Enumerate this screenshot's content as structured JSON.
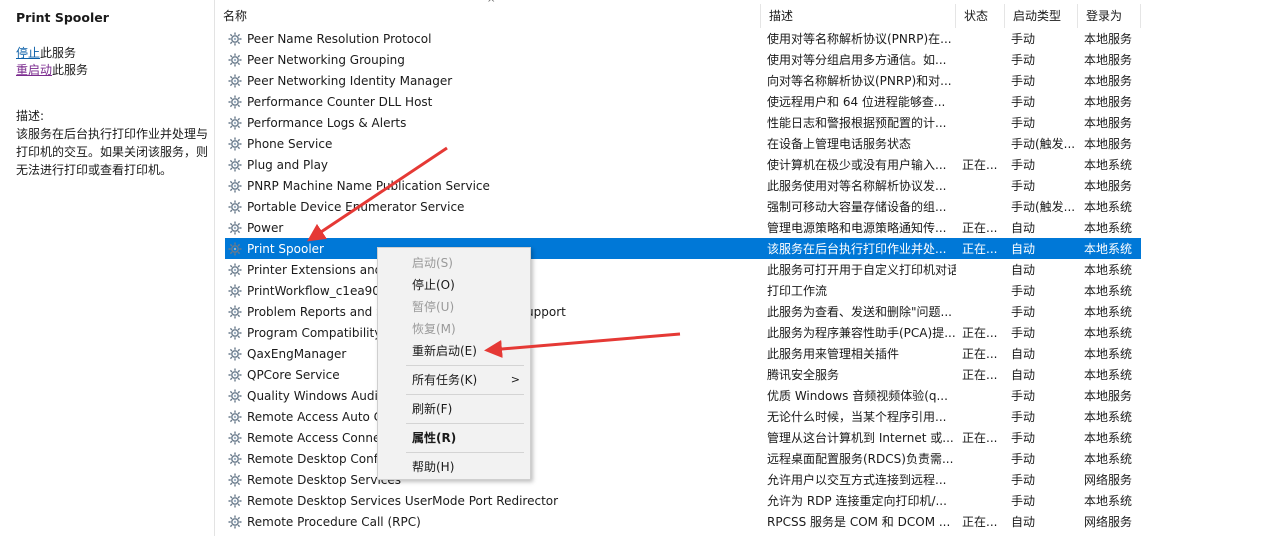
{
  "left_pane": {
    "service_title": "Print Spooler",
    "stop_link": "停止",
    "stop_suffix": "此服务",
    "restart_link": "重启动",
    "restart_suffix": "此服务",
    "desc_label": "描述:",
    "desc_text": "该服务在后台执行打印作业并处理与打印机的交互。如果关闭该服务，则无法进行打印或查看打印机。"
  },
  "columns": {
    "name": "名称",
    "description": "描述",
    "status": "状态",
    "startup": "启动类型",
    "logon": "登录为"
  },
  "services": [
    {
      "name": "Peer Name Resolution Protocol",
      "desc": "使用对等名称解析协议(PNRP)在...",
      "status": "",
      "startup": "手动",
      "logon": "本地服务"
    },
    {
      "name": "Peer Networking Grouping",
      "desc": "使用对等分组启用多方通信。如...",
      "status": "",
      "startup": "手动",
      "logon": "本地服务"
    },
    {
      "name": "Peer Networking Identity Manager",
      "desc": "向对等名称解析协议(PNRP)和对...",
      "status": "",
      "startup": "手动",
      "logon": "本地服务"
    },
    {
      "name": "Performance Counter DLL Host",
      "desc": "使远程用户和 64 位进程能够查...",
      "status": "",
      "startup": "手动",
      "logon": "本地服务"
    },
    {
      "name": "Performance Logs & Alerts",
      "desc": "性能日志和警报根据预配置的计...",
      "status": "",
      "startup": "手动",
      "logon": "本地服务"
    },
    {
      "name": "Phone Service",
      "desc": "在设备上管理电话服务状态",
      "status": "",
      "startup": "手动(触发...",
      "logon": "本地服务"
    },
    {
      "name": "Plug and Play",
      "desc": "使计算机在极少或没有用户输入...",
      "status": "正在...",
      "startup": "手动",
      "logon": "本地系统"
    },
    {
      "name": "PNRP Machine Name Publication Service",
      "desc": "此服务使用对等名称解析协议发...",
      "status": "",
      "startup": "手动",
      "logon": "本地服务"
    },
    {
      "name": "Portable Device Enumerator Service",
      "desc": "强制可移动大容量存储设备的组...",
      "status": "",
      "startup": "手动(触发...",
      "logon": "本地系统"
    },
    {
      "name": "Power",
      "desc": "管理电源策略和电源策略通知传...",
      "status": "正在...",
      "startup": "自动",
      "logon": "本地系统"
    },
    {
      "name": "Print Spooler",
      "desc": "该服务在后台执行打印作业并处...",
      "status": "正在...",
      "startup": "自动",
      "logon": "本地系统"
    },
    {
      "name": "Printer Extensions and",
      "desc": "此服务可打开用于自定义打印机对话...",
      "status": "",
      "startup": "自动",
      "logon": "本地系统"
    },
    {
      "name": "PrintWorkflow_c1ea905",
      "desc": "打印工作流",
      "status": "",
      "startup": "手动",
      "logon": "本地系统"
    },
    {
      "name": "Problem Reports and Solutions Control Panel Support",
      "desc": "此服务为查看、发送和删除\"问题...",
      "status": "",
      "startup": "手动",
      "logon": "本地系统"
    },
    {
      "name": "Program Compatibility",
      "desc": "此服务为程序兼容性助手(PCA)提...",
      "status": "正在...",
      "startup": "手动",
      "logon": "本地系统"
    },
    {
      "name": "QaxEngManager",
      "desc": "此服务用来管理相关插件",
      "status": "正在...",
      "startup": "自动",
      "logon": "本地系统"
    },
    {
      "name": "QPCore Service",
      "desc": "腾讯安全服务",
      "status": "正在...",
      "startup": "自动",
      "logon": "本地系统"
    },
    {
      "name": "Quality Windows Audio",
      "desc": "优质 Windows 音频视频体验(q...",
      "status": "",
      "startup": "手动",
      "logon": "本地服务"
    },
    {
      "name": "Remote Access Auto C",
      "desc": "无论什么时候，当某个程序引用...",
      "status": "",
      "startup": "手动",
      "logon": "本地系统"
    },
    {
      "name": "Remote Access Conne",
      "desc": "管理从这台计算机到 Internet 或...",
      "status": "正在...",
      "startup": "手动",
      "logon": "本地系统"
    },
    {
      "name": "Remote Desktop Confi",
      "desc": "远程桌面配置服务(RDCS)负责需...",
      "status": "",
      "startup": "手动",
      "logon": "本地系统"
    },
    {
      "name": "Remote Desktop Services",
      "desc": "允许用户以交互方式连接到远程...",
      "status": "",
      "startup": "手动",
      "logon": "网络服务"
    },
    {
      "name": "Remote Desktop Services UserMode Port Redirector",
      "desc": "允许为 RDP 连接重定向打印机/...",
      "status": "",
      "startup": "手动",
      "logon": "本地系统"
    },
    {
      "name": "Remote Procedure Call (RPC)",
      "desc": "RPCSS 服务是 COM 和 DCOM ...",
      "status": "正在...",
      "startup": "自动",
      "logon": "网络服务"
    }
  ],
  "selected_index": 10,
  "context_menu": {
    "start": "启动(S)",
    "stop": "停止(O)",
    "pause": "暂停(U)",
    "resume": "恢复(M)",
    "restart": "重新启动(E)",
    "all_tasks": "所有任务(K)",
    "refresh": "刷新(F)",
    "properties": "属性(R)",
    "help": "帮助(H)"
  },
  "colors": {
    "selection": "#0078d7",
    "annotation_arrow": "#e53935"
  }
}
